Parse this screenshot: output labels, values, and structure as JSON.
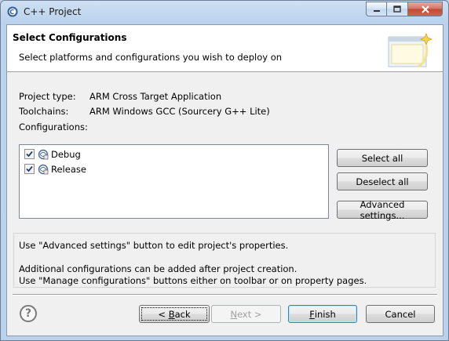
{
  "window": {
    "title": "C++ Project"
  },
  "header": {
    "title": "Select Configurations",
    "subtitle": "Select platforms and configurations you wish to deploy on"
  },
  "info": {
    "project_type_label": "Project type:",
    "project_type_value": "ARM Cross Target Application",
    "toolchains_label": "Toolchains:",
    "toolchains_value": "ARM Windows GCC (Sourcery G++ Lite)",
    "configurations_label": "Configurations:"
  },
  "configurations": [
    {
      "label": "Debug",
      "checked": true
    },
    {
      "label": "Release",
      "checked": true
    }
  ],
  "side_buttons": {
    "select_all": "Select all",
    "deselect_all": "Deselect all",
    "advanced": "Advanced settings..."
  },
  "notes": {
    "line1": "Use \"Advanced settings\" button to edit project's properties.",
    "line2": "Additional configurations can be added after project creation.",
    "line3": "Use \"Manage configurations\" buttons either on toolbar or on property pages."
  },
  "footer": {
    "help_glyph": "?",
    "back_prefix": "< ",
    "back_mnemonic": "B",
    "back_rest": "ack",
    "next_prefix": "",
    "next_mnemonic": "N",
    "next_rest": "ext >",
    "finish_mnemonic": "F",
    "finish_rest": "inish",
    "cancel": "Cancel"
  },
  "icons": {
    "app": "cpp-project-icon",
    "wizard": "wizard-banner-icon",
    "config": "configuration-icon",
    "help": "help-icon"
  },
  "colors": {
    "title_bar": "#bcd3ea",
    "close_button": "#c24a34",
    "focus_border": "#3c7fb1"
  }
}
